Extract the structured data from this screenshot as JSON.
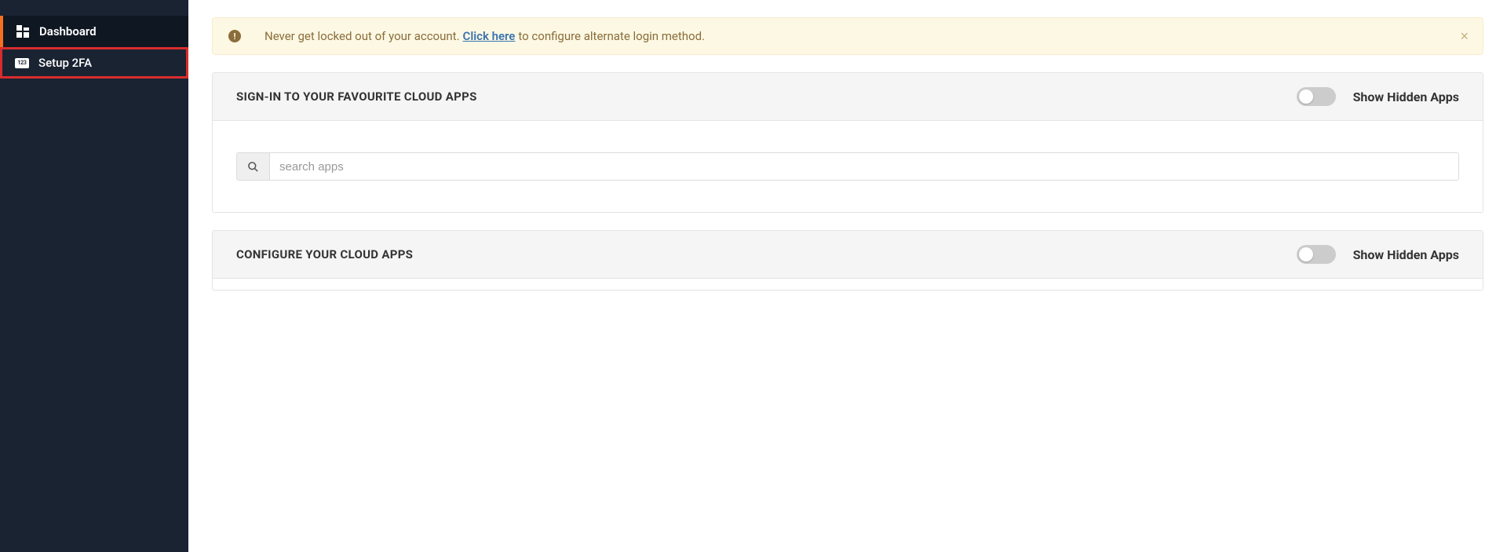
{
  "sidebar": {
    "items": [
      {
        "label": "Dashboard"
      },
      {
        "label": "Setup 2FA",
        "badge_text": "123"
      }
    ]
  },
  "alert": {
    "prefix": "Never get locked out of your account.",
    "link_text": "Click here",
    "suffix": "to configure alternate login method.",
    "close_symbol": "×",
    "icon_symbol": "!"
  },
  "panels": {
    "signin": {
      "title": "SIGN-IN TO YOUR FAVOURITE CLOUD APPS",
      "toggle_label": "Show Hidden Apps",
      "search_placeholder": "search apps"
    },
    "configure": {
      "title": "CONFIGURE YOUR CLOUD APPS",
      "toggle_label": "Show Hidden Apps"
    }
  }
}
